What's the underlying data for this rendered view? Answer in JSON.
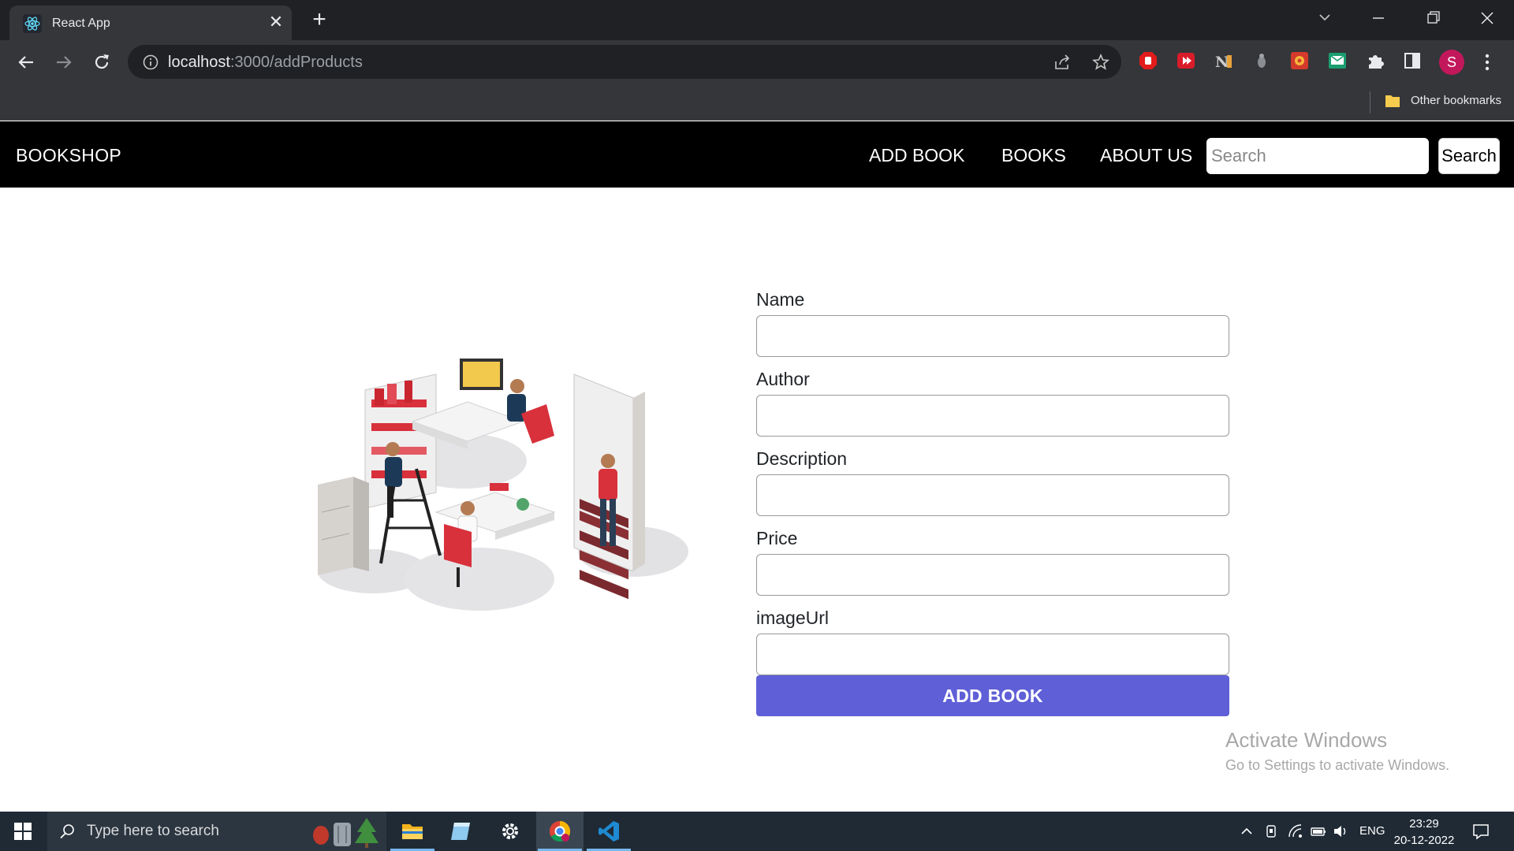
{
  "browser": {
    "tab_title": "React App",
    "url_host": "localhost",
    "url_rest": ":3000/addProducts",
    "bookmarks_other": "Other bookmarks",
    "profile_initial": "S"
  },
  "navbar": {
    "brand": "BOOKSHOP",
    "links": [
      "ADD BOOK",
      "BOOKS",
      "ABOUT US"
    ],
    "search_placeholder": "Search",
    "search_button": "Search"
  },
  "form": {
    "fields": [
      {
        "label": "Name",
        "value": ""
      },
      {
        "label": "Author",
        "value": ""
      },
      {
        "label": "Description",
        "value": ""
      },
      {
        "label": "Price",
        "value": ""
      },
      {
        "label": "imageUrl",
        "value": ""
      }
    ],
    "submit_label": "ADD BOOK",
    "submit_color": "#5f5fd7"
  },
  "watermark": {
    "title": "Activate Windows",
    "subtitle": "Go to Settings to activate Windows."
  },
  "taskbar": {
    "search_placeholder": "Type here to search",
    "language": "ENG",
    "time": "23:29",
    "date": "20-12-2022"
  }
}
